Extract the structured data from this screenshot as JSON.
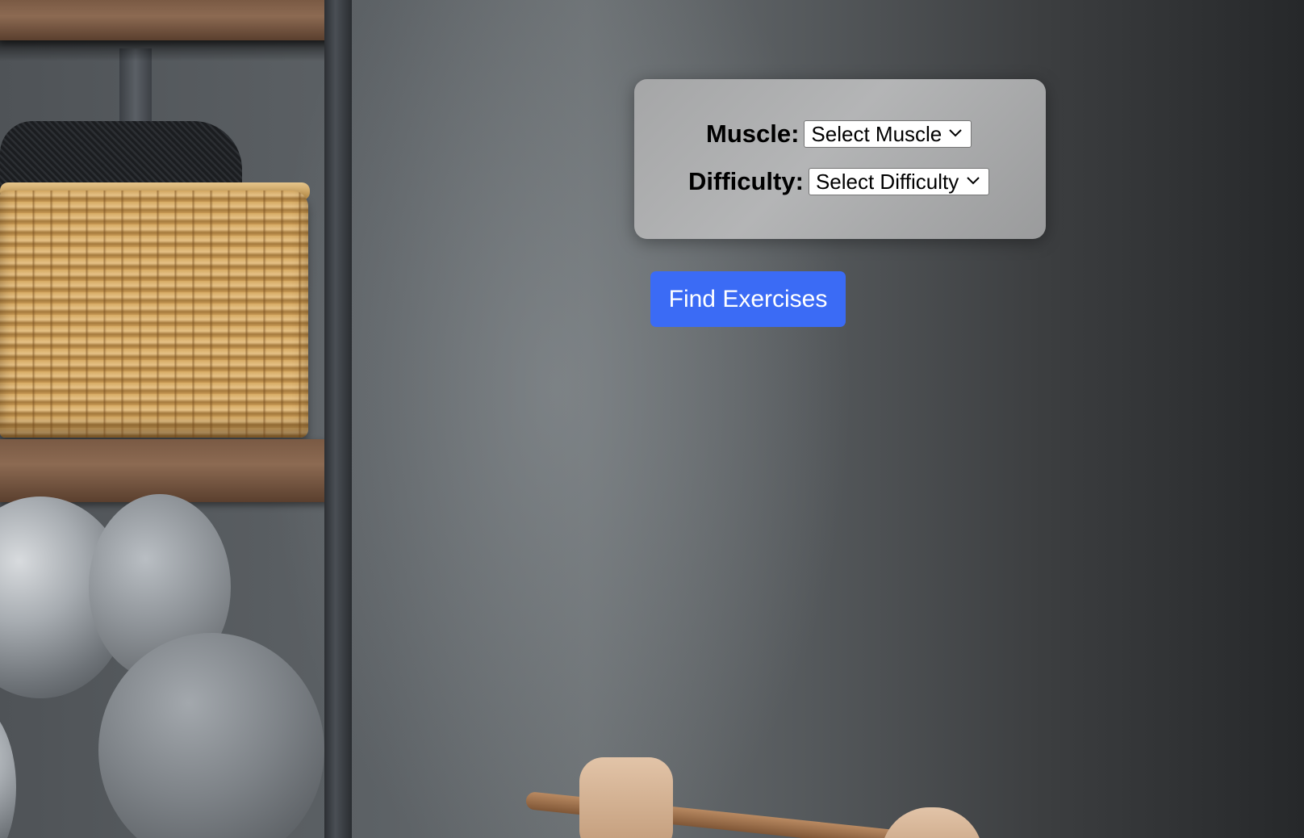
{
  "filters": {
    "muscle": {
      "label": "Muscle:",
      "selected": "Select Muscle"
    },
    "difficulty": {
      "label": "Difficulty:",
      "selected": "Select Difficulty"
    }
  },
  "actions": {
    "find_label": "Find Exercises"
  },
  "colors": {
    "button_bg": "#3b6bf5",
    "button_text": "#ffffff",
    "panel_bg": "#a9aaab"
  },
  "icons": {
    "select_chevron": "chevron-down-icon"
  }
}
